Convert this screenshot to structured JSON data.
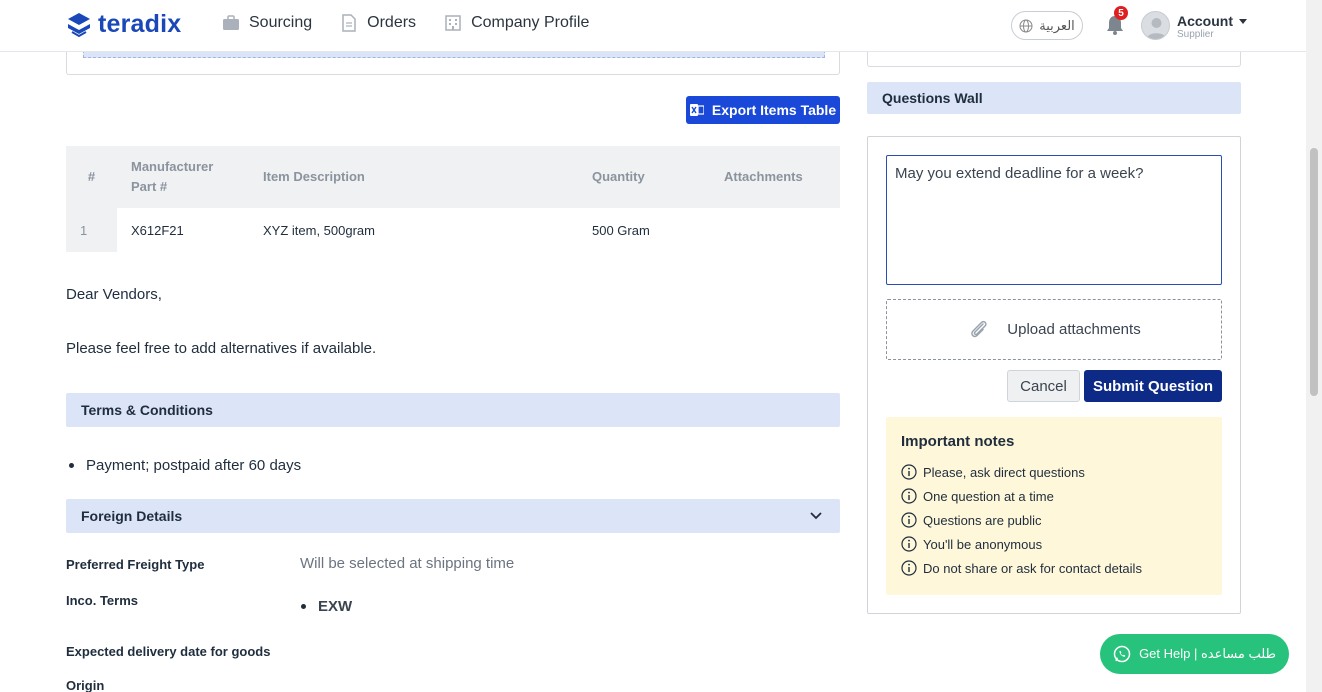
{
  "header": {
    "brand": "teradix",
    "nav": [
      {
        "label": "Sourcing",
        "icon": "briefcase-icon"
      },
      {
        "label": "Orders",
        "icon": "document-icon"
      },
      {
        "label": "Company Profile",
        "icon": "building-icon"
      }
    ],
    "language": "العربية",
    "notifications_count": "5",
    "account_name": "Account",
    "account_role": "Supplier"
  },
  "items": {
    "export_label": "Export Items Table",
    "columns": [
      "#",
      "Manufacturer Part #",
      "Item Description",
      "Quantity",
      "Attachments"
    ],
    "rows": [
      {
        "num": "1",
        "part": "X612F21",
        "description": "XYZ item, 500gram",
        "quantity": "500 Gram",
        "attachments": ""
      }
    ]
  },
  "message": {
    "greeting": "Dear Vendors,",
    "body": "Please feel free to add alternatives if available."
  },
  "terms": {
    "title": "Terms & Conditions",
    "items": [
      "Payment; postpaid after 60 days"
    ]
  },
  "foreign": {
    "title": "Foreign Details",
    "fields": {
      "freight_label": "Preferred Freight Type",
      "freight_value": "Will be selected at shipping time",
      "inco_label": "Inco. Terms",
      "inco_value": "EXW",
      "delivery_label": "Expected delivery date for goods",
      "origin_label": "Origin"
    }
  },
  "questions_wall": {
    "title": "Questions Wall",
    "question_text": "May you extend deadline for a week?",
    "upload_label": "Upload attachments",
    "cancel_label": "Cancel",
    "submit_label": "Submit Question",
    "notes_title": "Important notes",
    "notes": [
      "Please, ask direct questions",
      "One question at a time",
      "Questions are public",
      "You'll be anonymous",
      "Do not share or ask for contact details"
    ]
  },
  "help": {
    "label": "Get Help | طلب مساعده"
  },
  "colors": {
    "brand": "#1a48b8",
    "primary_button": "#1a48d8",
    "submit_button": "#0d2b86",
    "section_header": "#dbe5f7",
    "notes_bg": "#fff7d9",
    "help_button": "#27c27b",
    "badge": "#e02020"
  }
}
